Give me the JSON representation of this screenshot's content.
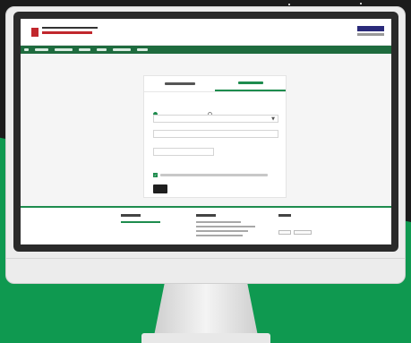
{
  "colors": {
    "page_background": "#0f9950",
    "nav_green": "#1e6b3e",
    "accent_green": "#1e8c4e",
    "brand_red": "#c1272d",
    "submit_button": "#1f1f1f"
  },
  "site": {
    "tabs": [
      {
        "label": "",
        "active": false
      },
      {
        "label": "",
        "active": true
      }
    ]
  },
  "form": {
    "radio_options": [
      {
        "label": "",
        "checked": true
      },
      {
        "label": "",
        "checked": false
      }
    ],
    "consent_checked": true
  },
  "footer": {
    "share_buttons": 2
  },
  "icons": {
    "select_caret": "chevron-down-icon",
    "consent_check": "check-icon"
  }
}
